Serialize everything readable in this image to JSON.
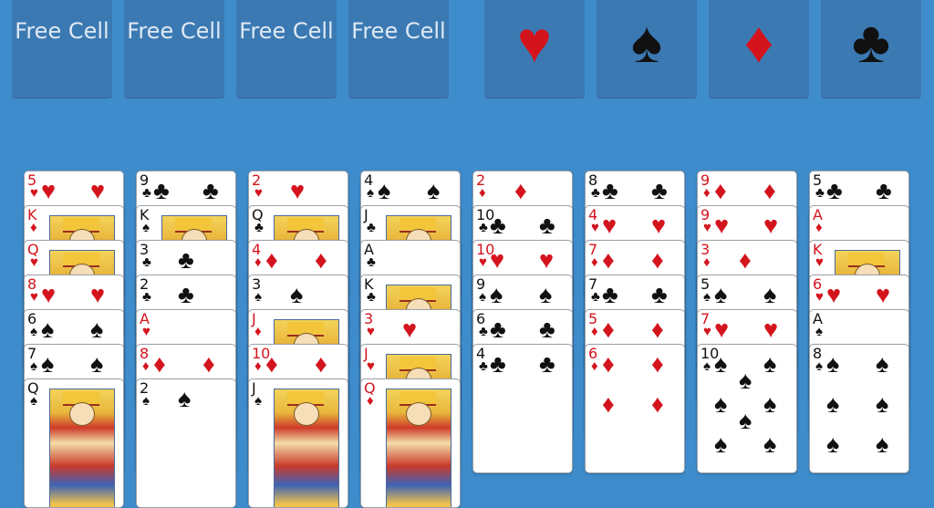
{
  "free_cells": [
    {
      "label": "Free Cell"
    },
    {
      "label": "Free Cell"
    },
    {
      "label": "Free Cell"
    },
    {
      "label": "Free Cell"
    }
  ],
  "foundations": [
    {
      "suit": "hearts",
      "symbol": "♥",
      "color": "#d4141d"
    },
    {
      "suit": "spades",
      "symbol": "♠",
      "color": "#111111"
    },
    {
      "suit": "diamonds",
      "symbol": "♦",
      "color": "#d4141d"
    },
    {
      "suit": "clubs",
      "symbol": "♣",
      "color": "#111111"
    }
  ],
  "colors": {
    "table": "#3f8ccc",
    "slot": "#3b79b3",
    "red": "#d4141d",
    "black": "#111111"
  },
  "tableau": [
    [
      {
        "rank": "5",
        "suit": "♥"
      },
      {
        "rank": "K",
        "suit": "♦"
      },
      {
        "rank": "Q",
        "suit": "♥"
      },
      {
        "rank": "8",
        "suit": "♥"
      },
      {
        "rank": "6",
        "suit": "♠"
      },
      {
        "rank": "7",
        "suit": "♠"
      },
      {
        "rank": "Q",
        "suit": "♠"
      }
    ],
    [
      {
        "rank": "9",
        "suit": "♣"
      },
      {
        "rank": "K",
        "suit": "♠"
      },
      {
        "rank": "3",
        "suit": "♣"
      },
      {
        "rank": "2",
        "suit": "♣"
      },
      {
        "rank": "A",
        "suit": "♥"
      },
      {
        "rank": "8",
        "suit": "♦"
      },
      {
        "rank": "2",
        "suit": "♠"
      }
    ],
    [
      {
        "rank": "2",
        "suit": "♥"
      },
      {
        "rank": "Q",
        "suit": "♣"
      },
      {
        "rank": "4",
        "suit": "♦"
      },
      {
        "rank": "3",
        "suit": "♠"
      },
      {
        "rank": "J",
        "suit": "♦"
      },
      {
        "rank": "10",
        "suit": "♦"
      },
      {
        "rank": "J",
        "suit": "♠"
      }
    ],
    [
      {
        "rank": "4",
        "suit": "♠"
      },
      {
        "rank": "J",
        "suit": "♣"
      },
      {
        "rank": "A",
        "suit": "♣"
      },
      {
        "rank": "K",
        "suit": "♣"
      },
      {
        "rank": "3",
        "suit": "♥"
      },
      {
        "rank": "J",
        "suit": "♥"
      },
      {
        "rank": "Q",
        "suit": "♦"
      }
    ],
    [
      {
        "rank": "2",
        "suit": "♦"
      },
      {
        "rank": "10",
        "suit": "♣"
      },
      {
        "rank": "10",
        "suit": "♥"
      },
      {
        "rank": "9",
        "suit": "♠"
      },
      {
        "rank": "6",
        "suit": "♣"
      },
      {
        "rank": "4",
        "suit": "♣"
      }
    ],
    [
      {
        "rank": "8",
        "suit": "♣"
      },
      {
        "rank": "4",
        "suit": "♥"
      },
      {
        "rank": "7",
        "suit": "♦"
      },
      {
        "rank": "7",
        "suit": "♣"
      },
      {
        "rank": "5",
        "suit": "♦"
      },
      {
        "rank": "6",
        "suit": "♦"
      }
    ],
    [
      {
        "rank": "9",
        "suit": "♦"
      },
      {
        "rank": "9",
        "suit": "♥"
      },
      {
        "rank": "3",
        "suit": "♦"
      },
      {
        "rank": "5",
        "suit": "♠"
      },
      {
        "rank": "7",
        "suit": "♥"
      },
      {
        "rank": "10",
        "suit": "♠"
      }
    ],
    [
      {
        "rank": "5",
        "suit": "♣"
      },
      {
        "rank": "A",
        "suit": "♦"
      },
      {
        "rank": "K",
        "suit": "♥"
      },
      {
        "rank": "6",
        "suit": "♥"
      },
      {
        "rank": "A",
        "suit": "♠"
      },
      {
        "rank": "8",
        "suit": "♠"
      }
    ]
  ]
}
